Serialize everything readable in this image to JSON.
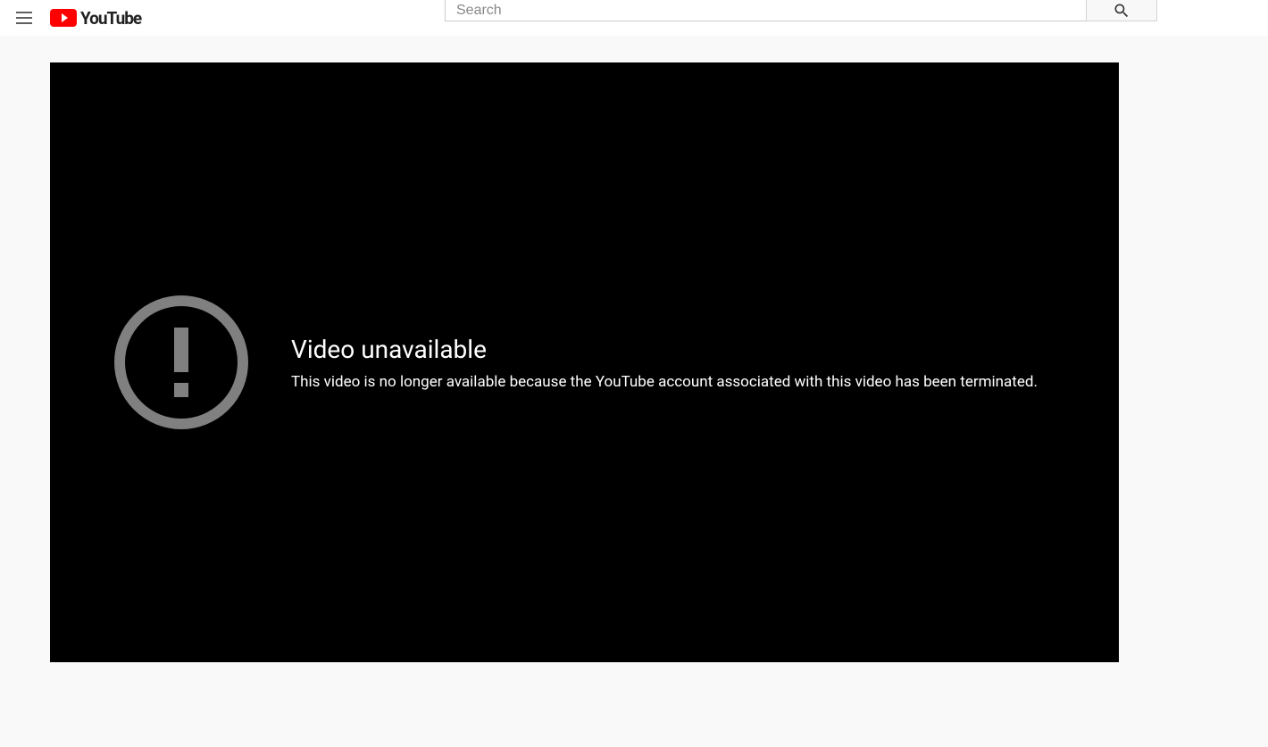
{
  "header": {
    "logo_text": "YouTube",
    "search_placeholder": "Search"
  },
  "player": {
    "error_title": "Video unavailable",
    "error_message": "This video is no longer available because the YouTube account associated with this video has been terminated."
  }
}
